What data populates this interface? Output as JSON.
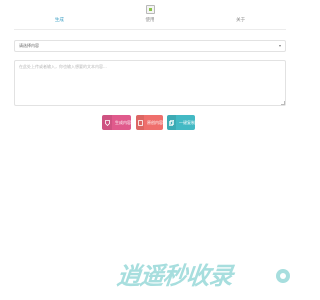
{
  "tabs": [
    "生成",
    "使用",
    "关于"
  ],
  "select": {
    "value": "请选择内容"
  },
  "editor": {
    "placeholder": "在此处上传或者输入，你也输入想要的文本内容..."
  },
  "buttons": {
    "ai_label": "生成内容",
    "original_label": "原创内容",
    "copy_label": "一键复制"
  },
  "footer": {
    "brand": "逍遥秒收录"
  },
  "colors": {
    "accent": "#45b1c9",
    "pink": "#e05a8c",
    "coral": "#ef6f6c",
    "teal": "#43b9c4",
    "watermark": "#a7dede"
  },
  "icons": [
    "image-placeholder-icon",
    "tag-icon",
    "document-icon",
    "copy-icon",
    "chevron-down-icon",
    "logo-badge-icon"
  ]
}
